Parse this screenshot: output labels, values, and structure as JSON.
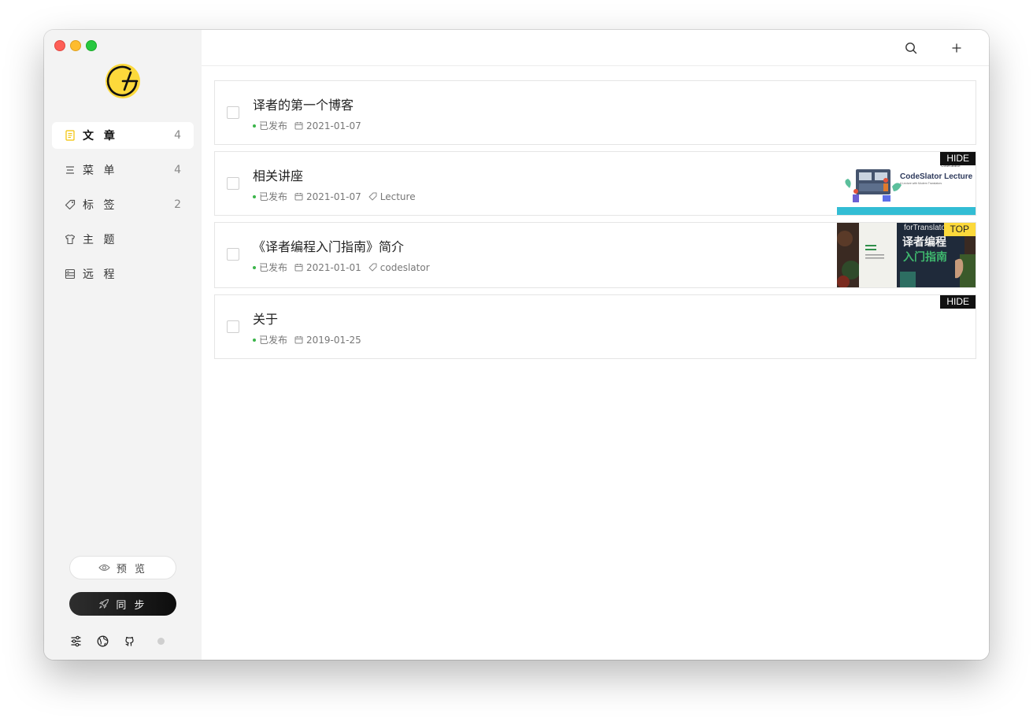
{
  "app": {
    "window_controls": [
      "close",
      "minimize",
      "zoom"
    ],
    "logo_icon": "gridea-logo-icon",
    "accent": "#fcd93b"
  },
  "sidebar": {
    "items": [
      {
        "label": "文 章",
        "count": "4",
        "icon": "document-icon",
        "active": true
      },
      {
        "label": "菜 单",
        "count": "4",
        "icon": "menu-icon"
      },
      {
        "label": "标 签",
        "count": "2",
        "icon": "tag-icon"
      },
      {
        "label": "主 题",
        "count": "",
        "icon": "shirt-icon"
      },
      {
        "label": "远 程",
        "count": "",
        "icon": "server-icon"
      }
    ],
    "preview_label": "预 览",
    "sync_label": "同 步",
    "footer_icons": [
      "settings-sliders-icon",
      "globe-icon",
      "github-icon"
    ],
    "status_dot_color": "#cfcfcf"
  },
  "toolbar": {
    "icons": [
      "search-icon",
      "plus-icon"
    ]
  },
  "posts": [
    {
      "title": "译者的第一个博客",
      "status": "已发布",
      "date": "2021-01-07",
      "tag": "",
      "badge": ""
    },
    {
      "title": "相关讲座",
      "status": "已发布",
      "date": "2021-01-07",
      "tag": "Lecture",
      "badge": "HIDE",
      "thumb": {
        "title": "CodeSlator Lecture",
        "subtitle": "CodeSlator",
        "sub2": "A Lecture with Modern Translators"
      }
    },
    {
      "title": "《译者编程入门指南》简介",
      "status": "已发布",
      "date": "2021-01-01",
      "tag": "codeslator",
      "badge": "TOP",
      "thumb": {
        "line1": "forTranslators",
        "line2": "译者编程",
        "line3": "入门指南"
      }
    },
    {
      "title": "关于",
      "status": "已发布",
      "date": "2019-01-25",
      "tag": "",
      "badge": "HIDE"
    }
  ],
  "colors": {
    "published_dot": "#3bb54a",
    "hide_badge": "#111111",
    "top_badge": "#fcd93b"
  }
}
